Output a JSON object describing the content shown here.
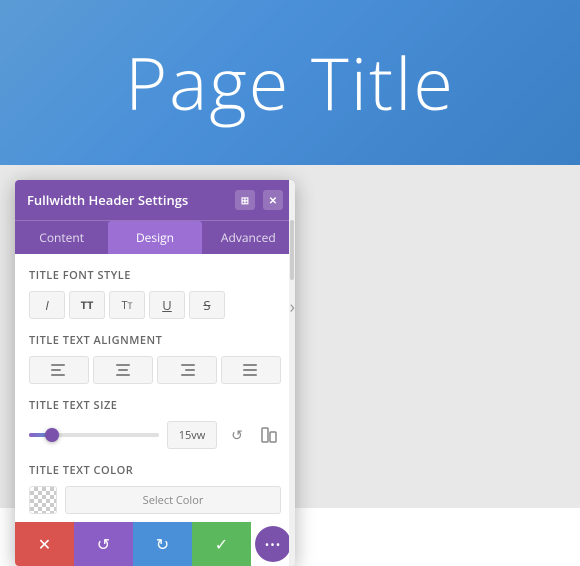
{
  "page": {
    "title": "Page Title",
    "background_gradient_start": "#5b9bd5",
    "background_gradient_end": "#3b7fc4"
  },
  "panel": {
    "title": "Fullwidth Header Settings",
    "tabs": [
      {
        "label": "Content",
        "active": false
      },
      {
        "label": "Design",
        "active": true
      },
      {
        "label": "Advanced",
        "active": false
      }
    ],
    "sections": {
      "font_style": {
        "label": "Title Font Style",
        "buttons": [
          "I",
          "TT",
          "T̲",
          "U",
          "S"
        ]
      },
      "text_alignment": {
        "label": "Title Text Alignment"
      },
      "text_size": {
        "label": "Title Text Size",
        "value": "15vw",
        "slider_percent": 18
      },
      "text_color": {
        "label": "Title Text Color",
        "select_label": "Select Color"
      }
    },
    "actions": {
      "cancel": "✕",
      "undo": "↺",
      "redo": "↻",
      "save": "✓",
      "more": "..."
    }
  }
}
